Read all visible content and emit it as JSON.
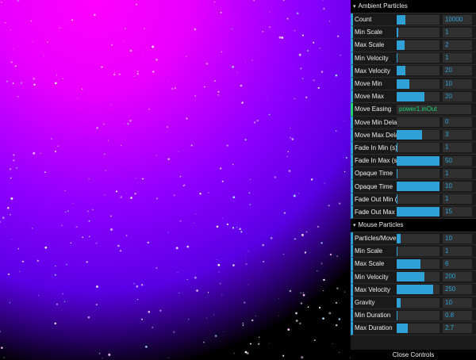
{
  "gui": {
    "folders": [
      {
        "title": "Ambient Particles",
        "rows": [
          {
            "label": "Count",
            "value": "10000",
            "fill": 0.2
          },
          {
            "label": "Min Scale",
            "value": "1",
            "fill": 0.04
          },
          {
            "label": "Max Scale",
            "value": "2",
            "fill": 0.18
          },
          {
            "label": "Min Velocity",
            "value": "1",
            "fill": 0.02
          },
          {
            "label": "Max Velocity",
            "value": "20",
            "fill": 0.2
          },
          {
            "label": "Move Min",
            "value": "10",
            "fill": 0.3
          },
          {
            "label": "Move Max",
            "value": "20",
            "fill": 0.65
          },
          {
            "label": "Move Easing",
            "value": "power1.inOut",
            "type": "string"
          },
          {
            "label": "Move Min Delay",
            "value": "0",
            "fill": 0
          },
          {
            "label": "Move Max Delay",
            "value": "3",
            "fill": 0.6
          },
          {
            "label": "Fade In Min (s)",
            "value": "1",
            "fill": 0.02
          },
          {
            "label": "Fade In Max (s)",
            "value": "50",
            "fill": 1.0
          },
          {
            "label": "Opaque Time",
            "value": "1",
            "fill": 0.02
          },
          {
            "label": "Opaque Time",
            "value": "10",
            "fill": 1.0
          },
          {
            "label": "Fade Out Min (s)",
            "value": "1",
            "fill": 0.02
          },
          {
            "label": "Fade Out Max (s)",
            "value": "15",
            "fill": 1.0
          }
        ]
      },
      {
        "title": "Mouse Particles",
        "rows": [
          {
            "label": "Particles/Move",
            "value": "10",
            "fill": 0.1
          },
          {
            "label": "Min Scale",
            "value": "1",
            "fill": 0.02
          },
          {
            "label": "Max Scale",
            "value": "6",
            "fill": 0.55
          },
          {
            "label": "Min Velocity",
            "value": "200",
            "fill": 0.65
          },
          {
            "label": "Max Velocity",
            "value": "250",
            "fill": 0.85
          },
          {
            "label": "Gravity",
            "value": "10",
            "fill": 0.1
          },
          {
            "label": "Min Duration",
            "value": "0.8",
            "fill": 0.02
          },
          {
            "label": "Max Duration",
            "value": "2.7",
            "fill": 0.25
          }
        ]
      }
    ],
    "close_label": "Close Controls"
  }
}
